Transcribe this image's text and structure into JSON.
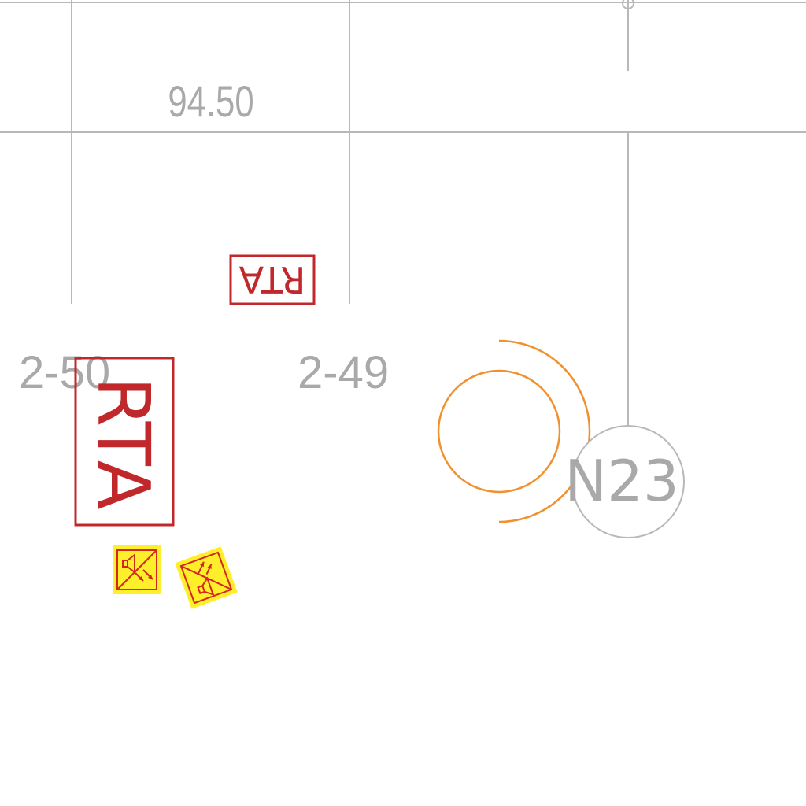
{
  "dimension": {
    "value": "94.50"
  },
  "rooms": [
    {
      "id": "2-50",
      "label": "2-50"
    },
    {
      "id": "2-49",
      "label": "2-49"
    }
  ],
  "rta_tags": [
    {
      "label": "RTA",
      "orientation": "rotated-180"
    },
    {
      "label": "RTA",
      "orientation": "rotated-90"
    }
  ],
  "grid_marker": {
    "label": "N23"
  },
  "symbols": [
    {
      "icon": "yellow-speaker-strobe-device-icon"
    },
    {
      "icon": "yellow-speaker-strobe-device-rotated-icon"
    }
  ],
  "colors": {
    "grid": "#b8b8b8",
    "label_gray": "#a9a9a9",
    "rta_red": "#c0282b",
    "arc_orange": "#f0902e",
    "symbol_yellow": "#ffee2a",
    "symbol_red": "#d2281e"
  }
}
